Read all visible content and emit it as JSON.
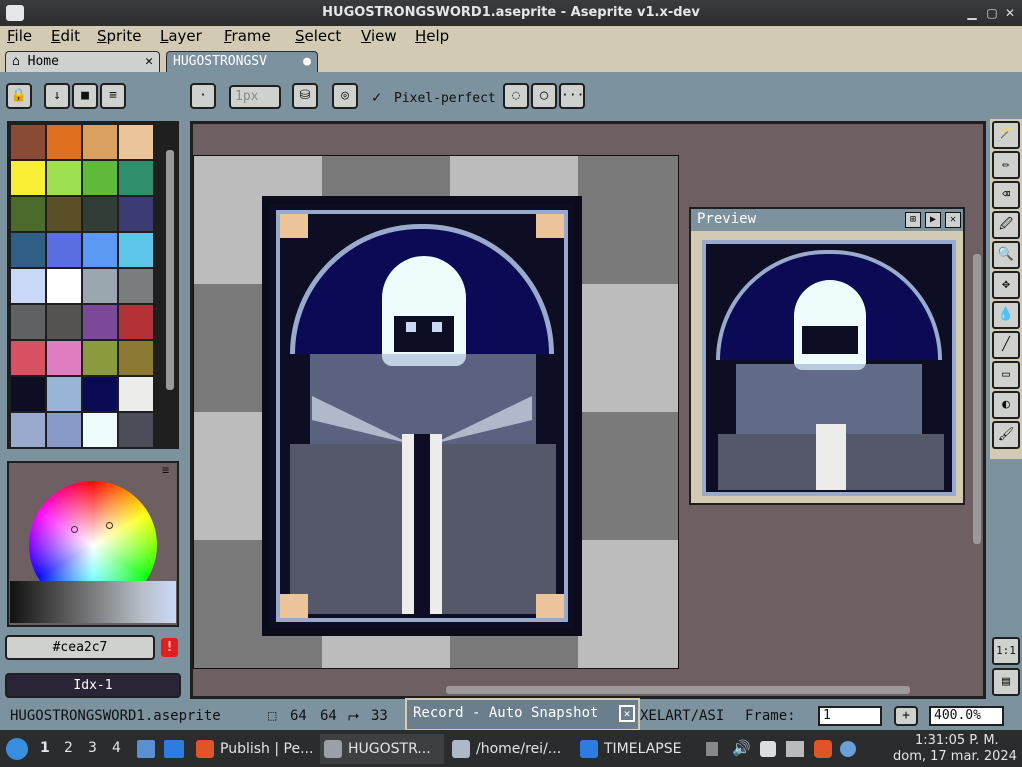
{
  "window": {
    "title": "HUGOSTRONGSWORD1.aseprite - Aseprite v1.x-dev",
    "minimize": "▁",
    "maximize": "▢",
    "close": "✕"
  },
  "menu": [
    "File",
    "Edit",
    "Sprite",
    "Layer",
    "Frame",
    "Select",
    "View",
    "Help"
  ],
  "tabs": {
    "home": "Home",
    "home_close": "✕",
    "file": "HUGOSTRONGSV",
    "file_dot": "●"
  },
  "toolbar": {
    "brush_size": "1px",
    "pixel_perfect_check": "✓",
    "pixel_perfect": "Pixel-perfect",
    "more": "···"
  },
  "colors": {
    "palette": [
      "#8a4b36",
      "#e07020",
      "#d9a060",
      "#ecc49a",
      "#f6ef34",
      "#9de050",
      "#5fb93b",
      "#2f8f6c",
      "#4d6a2d",
      "#5a4f26",
      "#313d35",
      "#3d3b73",
      "#305e85",
      "#5a6ee0",
      "#5b99f2",
      "#5ec7e9",
      "#cad8f7",
      "#ffffff",
      "#9aa7ae",
      "#7b7c7e",
      "#5e6263",
      "#545350",
      "#7c4898",
      "#b33238",
      "#d95063",
      "#e07cc0",
      "#8a9a3c",
      "#8d7a32",
      "#0d0d24",
      "#98b4d6",
      "#0b0b55",
      "#ececea",
      "#9aaacc",
      "#8a9ac8",
      "#eefcfc",
      "#4c4d58"
    ],
    "sprite_bg": "#0d0d24",
    "ui_bg": "#7d929f"
  },
  "color_fields": {
    "hex": "#cea2c7",
    "warn": "!",
    "index": "Idx-1"
  },
  "preview": {
    "title": "Preview"
  },
  "tools": [
    "🪄",
    "✏",
    "⌫",
    "🖉",
    "🔍",
    "✥",
    "💧",
    "╱",
    "▭",
    "◐",
    "🖌"
  ],
  "tools_bottom": [
    "1:1",
    "▤"
  ],
  "status": {
    "filename": "HUGOSTRONGSWORD1.aseprite",
    "size_w": "64",
    "size_h": "64",
    "pos_x": "33",
    "path_fragment": "XELART/ASI",
    "frame_label": "Frame:",
    "frame_value": "1",
    "zoom": "400.0%",
    "plus": "+"
  },
  "record_panel": {
    "label": "Record - Auto Snapshot",
    "close": "✕"
  },
  "taskbar": {
    "workspaces": [
      "1",
      "2",
      "3",
      "4"
    ],
    "tasks": [
      {
        "label": "Publish | Pe...",
        "icon_color": "#e0542a"
      },
      {
        "label": "HUGOSTR...",
        "icon_color": "#9aa0a6"
      },
      {
        "label": "/home/rei/...",
        "icon_color": "#aeb8c8"
      },
      {
        "label": "TIMELAPSE",
        "icon_color": "#2d7de0"
      }
    ],
    "time": "1:31:05 P. M.",
    "date": "dom, 17 mar. 2024"
  }
}
